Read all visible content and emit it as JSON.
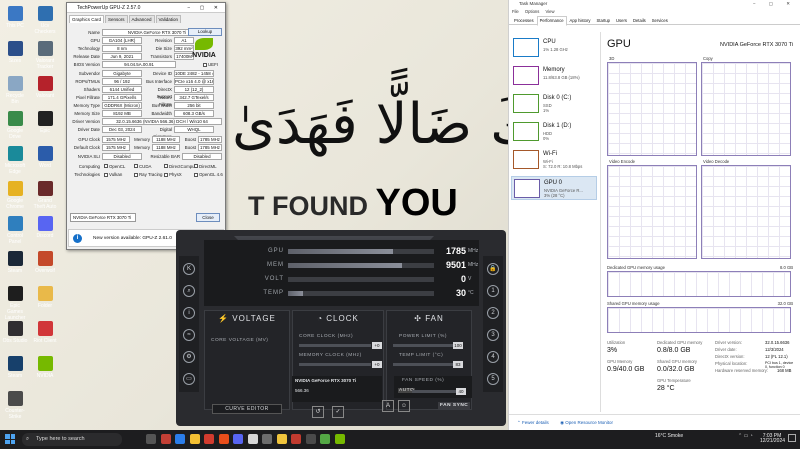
{
  "desktop": {
    "wallpaper_arabic": "كَ ضَالًّا فَهَدَىٰ",
    "wallpaper_text_1": "T FOUND",
    "wallpaper_text_2": "YOU",
    "icons": [
      {
        "label": "This PC",
        "color": "#3b78c4"
      },
      {
        "label": "Ucv Checkers",
        "color": "#2f6fb0"
      },
      {
        "label": "Sizes",
        "color": "#2c4f8a"
      },
      {
        "label": "Valorant Tracker",
        "color": "#5a6b7a"
      },
      {
        "label": "Recycle Bin",
        "color": "#8aa7c4"
      },
      {
        "label": "Valorant",
        "color": "#b5222b"
      },
      {
        "label": "Google Drive",
        "color": "#3a8b4a"
      },
      {
        "label": "Epic",
        "color": "#222222"
      },
      {
        "label": "Microsoft Edge",
        "color": "#1a8a9a"
      },
      {
        "label": "Word",
        "color": "#2b5caa"
      },
      {
        "label": "Google Chrome",
        "color": "#e6b222"
      },
      {
        "label": "Grand Theft Auto",
        "color": "#6a2a2a"
      },
      {
        "label": "Control Panel",
        "color": "#2f7fbe"
      },
      {
        "label": "Discord",
        "color": "#5865f2"
      },
      {
        "label": "Steam",
        "color": "#1b2838"
      },
      {
        "label": "Overwolf",
        "color": "#c4492a"
      },
      {
        "label": "Epic Games Launcher",
        "color": "#1e1e1e"
      },
      {
        "label": "Folder",
        "color": "#e9b949"
      },
      {
        "label": "Obs Studio",
        "color": "#302e31"
      },
      {
        "label": "Riot Client",
        "color": "#d13639"
      },
      {
        "label": "Steam",
        "color": "#17406b"
      },
      {
        "label": "NVIDIA",
        "color": "#76b900"
      },
      {
        "label": "Counter-Strike",
        "color": "#4b4b4b"
      }
    ]
  },
  "gpuz": {
    "title": "TechPowerUp GPU-Z 2.57.0",
    "tabs": [
      "Graphics Card",
      "Sensors",
      "Advanced",
      "Validation"
    ],
    "lookup": "Lookup",
    "nvidia_label": "NVIDIA",
    "rows": {
      "name_label": "Name",
      "name": "NVIDIA GeForce RTX 3070 Ti",
      "gpu_label": "GPU",
      "gpu": "GA104 (LHR)",
      "revision_label": "Revision",
      "revision": "A1",
      "technology_label": "Technology",
      "technology": "8 nm",
      "die_size_label": "Die Size",
      "die_size": "392 mm²",
      "release_label": "Release Date",
      "release": "Jun 9, 2021",
      "transistors_label": "Transistors",
      "transistors": "17400M",
      "bios_label": "BIOS Version",
      "bios": "94.04.5A.00.91",
      "uefi": "UEFI",
      "subvendor_label": "Subvendor",
      "subvendor": "Gigabyte",
      "device_id_label": "Device ID",
      "device_id": "10DE 2482 - 1458 405F",
      "rops_label": "ROPs/TMUs",
      "rops": "96 / 192",
      "bus_label": "Bus Interface",
      "bus": "PCIe x16 4.0 @ x16 1.1",
      "shaders_label": "Shaders",
      "shaders": "6144 Unified",
      "dx_label": "DirectX Support",
      "dx": "12 (12_2)",
      "pixel_label": "Pixel Fillrate",
      "pixel": "171.4 GPixel/s",
      "texture_label": "Texture Fillrate",
      "texture": "342.7 GTexel/s",
      "memtype_label": "Memory Type",
      "memtype": "GDDR6X (Micron)",
      "buswidth_label": "Bus Width",
      "buswidth": "256 bit",
      "memsize_label": "Memory Size",
      "memsize": "8192 MB",
      "bandwidth_label": "Bandwidth",
      "bandwidth": "608.3 GB/s",
      "driver_label": "Driver Version",
      "driver": "32.0.15.6636 (NVIDIA 566.36) DCH / Win10 64",
      "driverdate_label": "Driver Date",
      "driverdate": "Dec 03, 2024",
      "digsig_label": "Digital Signature",
      "digsig": "WHQL",
      "gpuclock_label": "GPU Clock",
      "gpuclock": "1575 MHz",
      "mem_label": "Memory",
      "memclk": "1188 MHz",
      "boost_label": "Boost",
      "boost": "1785 MHz",
      "defclock_label": "Default Clock",
      "defclock": "1575 MHz",
      "defmem": "1188 MHz",
      "defboost": "1785 MHz",
      "sli_label": "NVIDIA SLI",
      "sli": "Disabled",
      "rebar_label": "Resizable BAR",
      "rebar": "Disabled"
    },
    "computing_label": "Computing",
    "computing": [
      "OpenCL",
      "CUDA",
      "DirectCompute",
      "DirectML"
    ],
    "tech_label": "Technologies",
    "technologies": [
      "Vulkan",
      "Ray Tracing",
      "PhysX",
      "OpenGL 4.6"
    ],
    "select": "NVIDIA GeForce RTX 3070 Ti",
    "close": "Close",
    "notice": "New version available: GPU-Z 2.61.0",
    "update": "Update Now"
  },
  "msi": {
    "logo": "msi",
    "monitors": [
      {
        "label": "GPU",
        "value": "1785",
        "unit": "MHz",
        "fill": 0.72
      },
      {
        "label": "MEM",
        "value": "9501",
        "unit": "MHz",
        "fill": 0.78
      },
      {
        "label": "VOLT",
        "value": "0",
        "unit": "V",
        "fill": 0
      },
      {
        "label": "TEMP",
        "value": "30",
        "unit": "°C",
        "fill": 0.1
      }
    ],
    "voltage_title": "VOLTAGE",
    "core_voltage": "CORE VOLTAGE",
    "core_voltage_unit": "(MV)",
    "clock_title": "CLOCK",
    "core_clock": "CORE CLOCK",
    "core_clock_unit": "(MHz)",
    "core_clock_val": "+0",
    "memory_clock": "MEMORY CLOCK",
    "memory_clock_unit": "(MHz)",
    "memory_clock_val": "+0",
    "fan_title": "FAN",
    "power_limit": "POWER LIMIT",
    "power_limit_unit": "(%)",
    "power_limit_val": "100",
    "temp_limit": "TEMP LIMIT",
    "temp_limit_unit": "(°C)",
    "temp_limit_val": "83",
    "gpu_name": "NVIDIA GeForce RTX 3070 Ti",
    "driver": "566.36",
    "fan_speed": "FAN SPEED",
    "fan_speed_unit": "(%)",
    "fan_speed_val": "40",
    "curve_editor": "CURVE EDITOR",
    "fan_sync": "FAN SYNC",
    "auto": "AUTO"
  },
  "taskman": {
    "title": "Task Manager",
    "menu": [
      "File",
      "Options",
      "View"
    ],
    "tabs": [
      "Processes",
      "Performance",
      "App history",
      "Startup",
      "Users",
      "Details",
      "Services"
    ],
    "active_tab": "Performance",
    "side": [
      {
        "name": "CPU",
        "sub1": "1% 1.28 GHz",
        "sub2": "",
        "color": "#1a7bc7"
      },
      {
        "name": "Memory",
        "sub1": "11.8/63.8 GB (18%)",
        "sub2": "",
        "color": "#8b2f9a"
      },
      {
        "name": "Disk 0 (C:)",
        "sub1": "SSD",
        "sub2": "1%",
        "color": "#4f9a2e"
      },
      {
        "name": "Disk 1 (D:)",
        "sub1": "HDD",
        "sub2": "0%",
        "color": "#4f9a2e"
      },
      {
        "name": "Wi-Fi",
        "sub1": "Wi-Fi",
        "sub2": "S: 72.0 R: 10.8 Mbps",
        "color": "#a5582a"
      },
      {
        "name": "GPU 0",
        "sub1": "NVIDIA GeForce R...",
        "sub2": "3% (28 °C)",
        "color": "#6a5ca8"
      }
    ],
    "gpu_title": "GPU",
    "gpu_name": "NVIDIA GeForce RTX 3070 Ti",
    "engines": [
      "3D",
      "Copy",
      "Video Encode",
      "Video Decode"
    ],
    "dedicated_label": "Dedicated GPU memory usage",
    "dedicated_max": "8.0 GB",
    "shared_label": "Shared GPU memory usage",
    "shared_max": "32.0 GB",
    "stats": {
      "util_label": "Utilization",
      "util": "3%",
      "dedmem_label": "Dedicated GPU memory",
      "dedmem": "0.8/8.0 GB",
      "gpumem_label": "GPU Memory",
      "gpumem": "0.9/40.0 GB",
      "shmem_label": "Shared GPU memory",
      "shmem": "0.0/32.0 GB",
      "temp_label": "GPU Temperature",
      "temp": "28 °C",
      "dv_label": "Driver version:",
      "dv": "32.0.15.6636",
      "dd_label": "Driver date:",
      "dd": "12/3/2024",
      "dx_label": "DirectX version:",
      "dx": "12 (FL 12.1)",
      "pl_label": "Physical location:",
      "pl": "PCI bus 1, device 0, function 0",
      "hw_label": "Hardware reserved memory:",
      "hw": "168 MB"
    },
    "fewer": "Fewer details",
    "resmon": "Open Resource Monitor"
  },
  "taskbar": {
    "search": "Type here to search",
    "weather": "16°C  Smoke",
    "time": "7:03 PM",
    "date": "12/21/2024",
    "app_colors": [
      "#555555",
      "#c23f35",
      "#2b7de9",
      "#f4c033",
      "#d23b2e",
      "#e94e1b",
      "#5865f2",
      "#d7d7d7",
      "#6d6d6d",
      "#f0c43c",
      "#c13b2f",
      "#4a4a4a",
      "#54a845",
      "#76b900"
    ]
  }
}
